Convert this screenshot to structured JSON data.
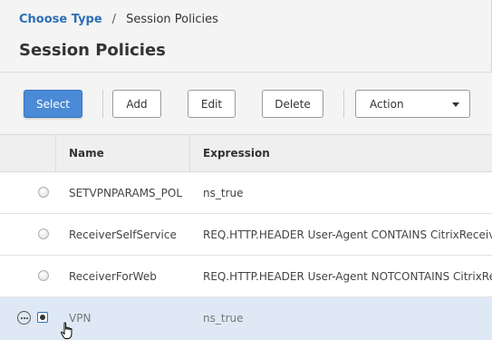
{
  "breadcrumb": {
    "parent": "Choose Type",
    "separator": "/",
    "current": "Session Policies"
  },
  "page_title": "Session Policies",
  "toolbar": {
    "select_label": "Select",
    "add_label": "Add",
    "edit_label": "Edit",
    "delete_label": "Delete",
    "action_label": "Action"
  },
  "table": {
    "headers": {
      "name": "Name",
      "expression": "Expression"
    },
    "rows": [
      {
        "name": "SETVPNPARAMS_POL",
        "expression": "ns_true",
        "selected": false
      },
      {
        "name": "ReceiverSelfService",
        "expression": "REQ.HTTP.HEADER User-Agent CONTAINS CitrixReceiver",
        "selected": false
      },
      {
        "name": "ReceiverForWeb",
        "expression": "REQ.HTTP.HEADER User-Agent NOTCONTAINS CitrixReceiver",
        "selected": false
      },
      {
        "name": "VPN",
        "expression": "ns_true",
        "selected": true
      }
    ]
  },
  "icons": {
    "row_menu": "more-options-icon",
    "dropdown": "chevron-down-icon",
    "pointer": "hand-pointer-cursor-icon"
  },
  "colors": {
    "primary_button": "#4a8ad6",
    "link": "#2e6fb5",
    "selected_row": "#dfe9f5"
  }
}
